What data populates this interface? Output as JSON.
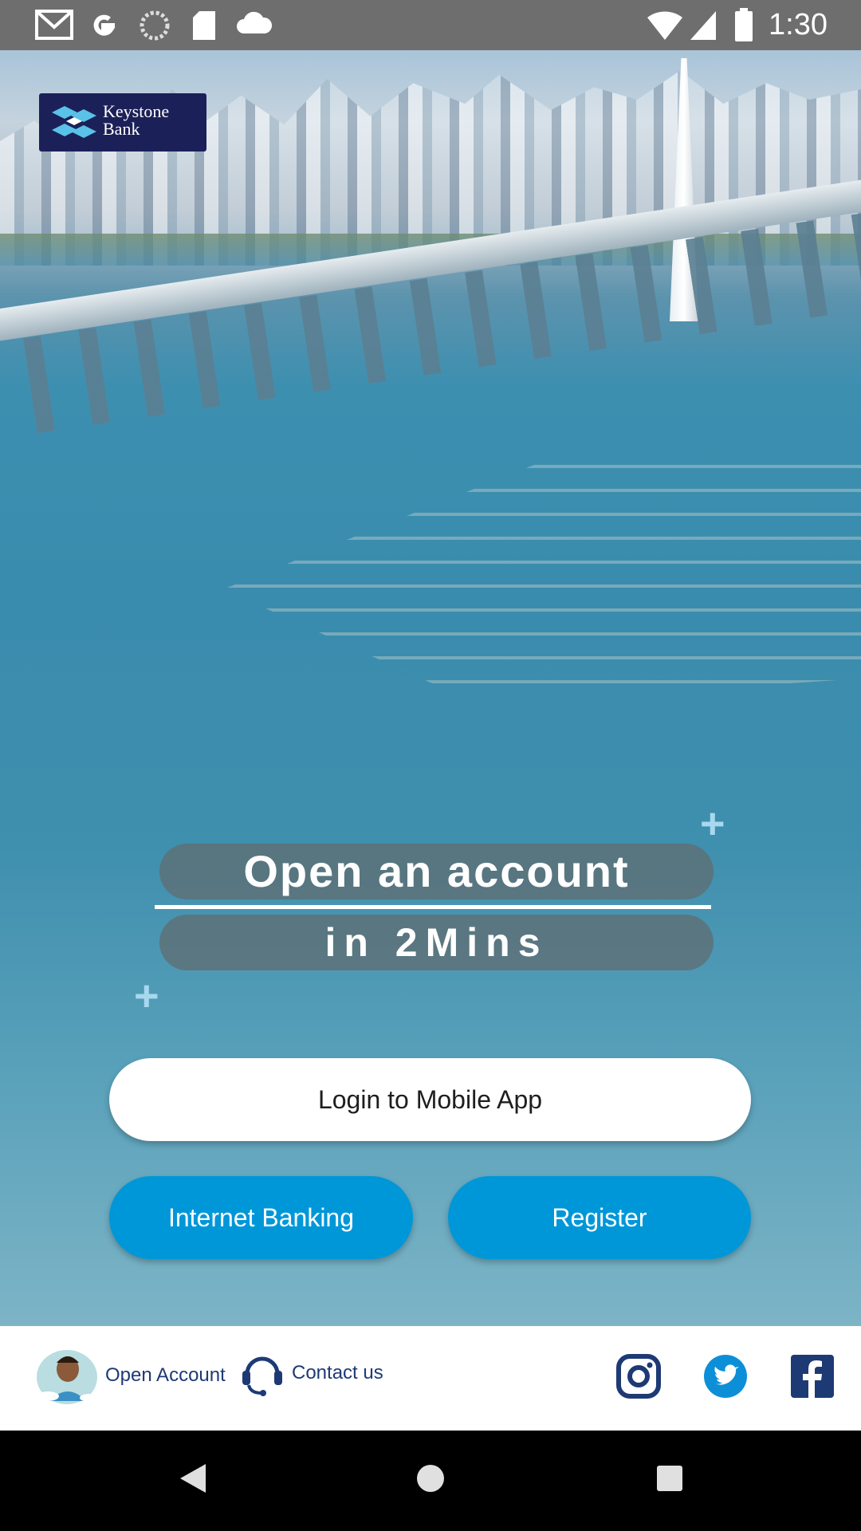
{
  "status_bar": {
    "time": "1:30",
    "left_icons": [
      "gmail-icon",
      "google-icon",
      "sync-icon",
      "sd-card-icon",
      "cloud-icon"
    ],
    "right_icons": [
      "wifi-icon",
      "signal-icon",
      "battery-icon"
    ]
  },
  "logo": {
    "name": "Keystone Bank",
    "line1": "Keystone",
    "line2": "Bank"
  },
  "promo": {
    "line1": "Open an account",
    "line2": "in 2Mins"
  },
  "buttons": {
    "login": "Login to Mobile App",
    "internet_banking": "Internet Banking",
    "register": "Register"
  },
  "footer": {
    "open_account": "Open Account",
    "contact_us": "Contact us",
    "social": [
      "instagram-icon",
      "twitter-icon",
      "facebook-icon"
    ]
  },
  "colors": {
    "primary_blue": "#0097d9",
    "navy": "#1d3a75",
    "logo_bg": "#1c2058",
    "status_bar": "#6e6e6e"
  }
}
